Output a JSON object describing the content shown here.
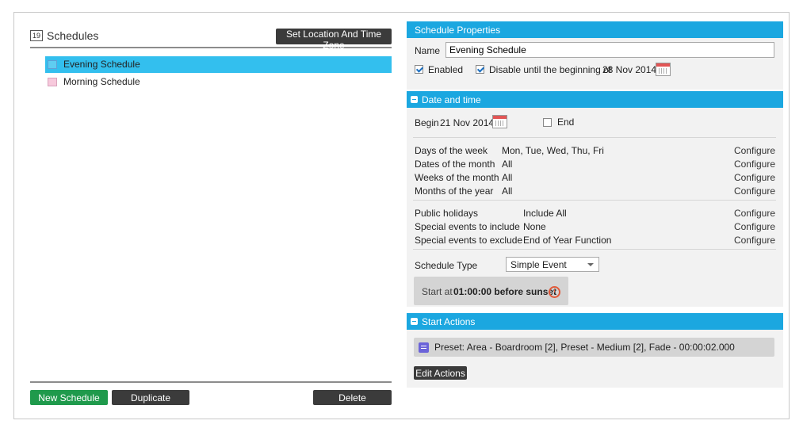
{
  "left": {
    "title": "Schedules",
    "icon_number": "19",
    "location_button": "Set Location And Time Zone",
    "schedules": [
      {
        "label": "Evening Schedule",
        "selected": true
      },
      {
        "label": "Morning Schedule",
        "selected": false
      }
    ],
    "footer": {
      "new_label": "New Schedule",
      "duplicate_label": "Duplicate",
      "delete_label": "Delete"
    }
  },
  "props": {
    "title": "Schedule Properties",
    "name_label": "Name",
    "name_value": "Evening Schedule",
    "enabled_label": "Enabled",
    "enabled_checked": true,
    "disable_label": "Disable until the beginning of",
    "disable_checked": true,
    "disable_date": "28 Nov 2014"
  },
  "datetime": {
    "title": "Date and time",
    "begin_label": "Begin",
    "begin_date": "21 Nov 2014",
    "end_label": "End",
    "end_checked": false,
    "rows": [
      {
        "label": "Days of the week",
        "value": "Mon, Tue, Wed, Thu, Fri",
        "action": "Configure"
      },
      {
        "label": "Dates of the month",
        "value": "All",
        "action": "Configure"
      },
      {
        "label": "Weeks of the month",
        "value": "All",
        "action": "Configure"
      },
      {
        "label": "Months of the year",
        "value": "All",
        "action": "Configure"
      }
    ],
    "rows2": [
      {
        "label": "Public holidays",
        "value": "Include All",
        "action": "Configure"
      },
      {
        "label": "Special events to include",
        "value": "None",
        "action": "Configure"
      },
      {
        "label": "Special events to exclude",
        "value": "End of Year Function",
        "action": "Configure"
      }
    ],
    "type_label": "Schedule Type",
    "type_value": "Simple Event",
    "start_label": "Start at",
    "start_value": "01:00:00 before sunset"
  },
  "actions": {
    "title": "Start Actions",
    "item": "Preset: Area - Boardroom [2], Preset - Medium [2], Fade - 00:00:02.000",
    "edit_label": "Edit Actions"
  },
  "colors": {
    "accent": "#1ba7e0",
    "selected_row": "#33bfee",
    "new_button": "#1f9a4c",
    "dark_button": "#3b3b3b"
  }
}
